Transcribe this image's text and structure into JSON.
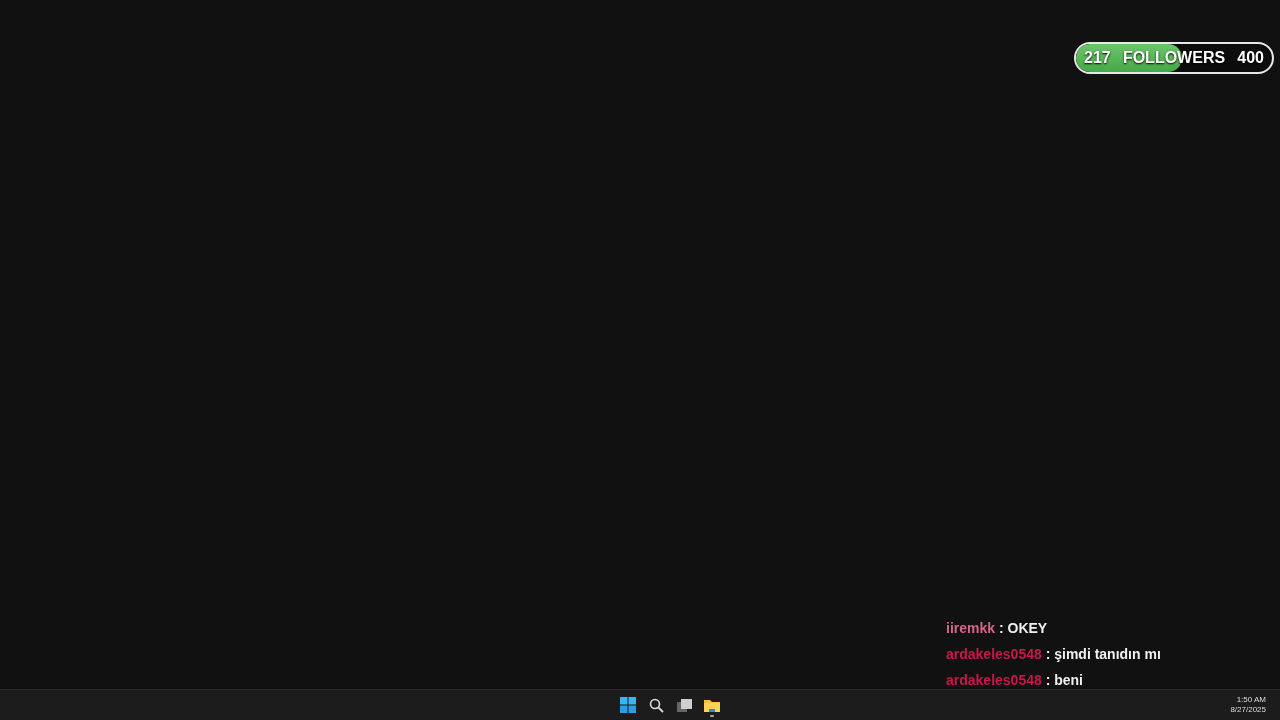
{
  "follower_goal": {
    "current": "217",
    "label": "FOLLOWERS",
    "target": "400",
    "level": 0.54
  },
  "chat": [
    {
      "user": "iiremkk",
      "color": "#d4668a",
      "message": ": OKEY"
    },
    {
      "user": "ardakeles0548",
      "color": "#c8174a",
      "message": ": şimdi tanıdın mı"
    },
    {
      "user": "ardakeles0548",
      "color": "#c8174a",
      "message": ": beni"
    }
  ],
  "taskbar": {
    "apps": [
      {
        "kind": "start",
        "running": false
      },
      {
        "kind": "search",
        "running": false
      },
      {
        "kind": "task-view",
        "running": false
      },
      {
        "kind": "file-explorer",
        "running": true
      }
    ],
    "time": "1:50 AM",
    "date": "8/27/2025"
  }
}
